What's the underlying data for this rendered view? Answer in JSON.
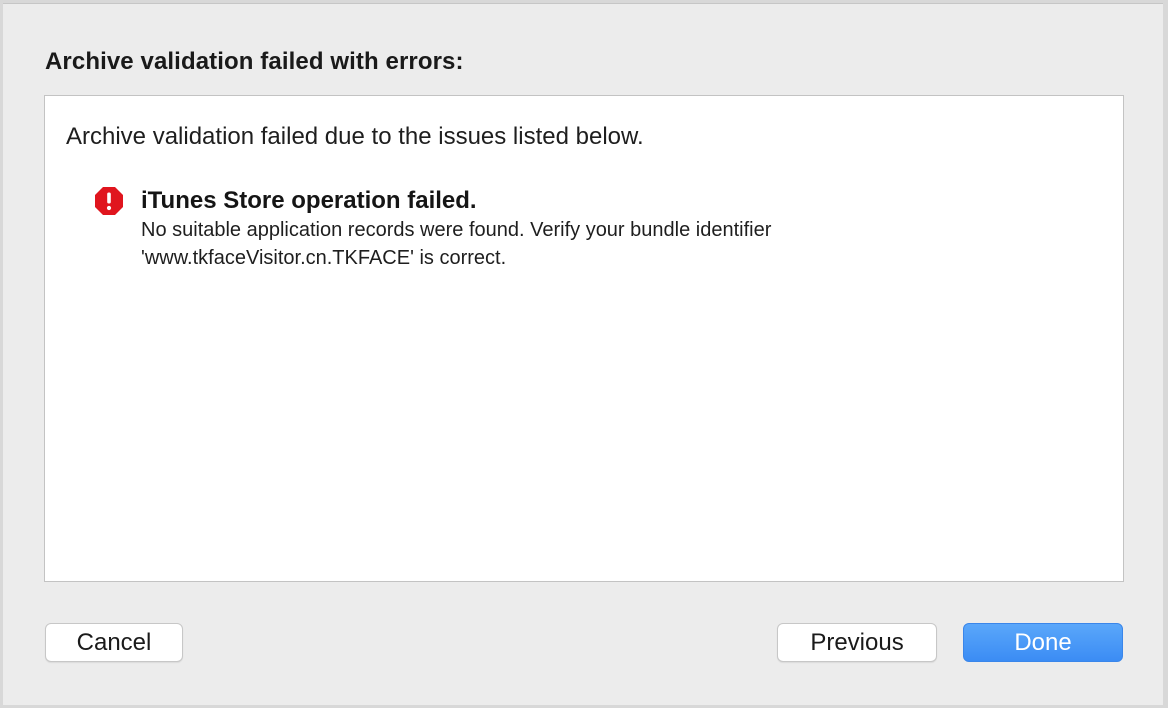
{
  "dialog": {
    "title": "Archive validation failed with errors:",
    "summary": "Archive validation failed due to the issues listed below.",
    "issues": [
      {
        "icon": "error-stop-icon",
        "title": "iTunes Store operation failed.",
        "detail_line1": "No suitable application records were found. Verify your bundle identifier",
        "detail_line2": "'www.tkfaceVisitor.cn.TKFACE' is correct."
      }
    ]
  },
  "buttons": {
    "cancel_label": "Cancel",
    "previous_label": "Previous",
    "done_label": "Done"
  },
  "colors": {
    "error_red": "#e0151e",
    "primary_blue": "#3b8cf4"
  }
}
